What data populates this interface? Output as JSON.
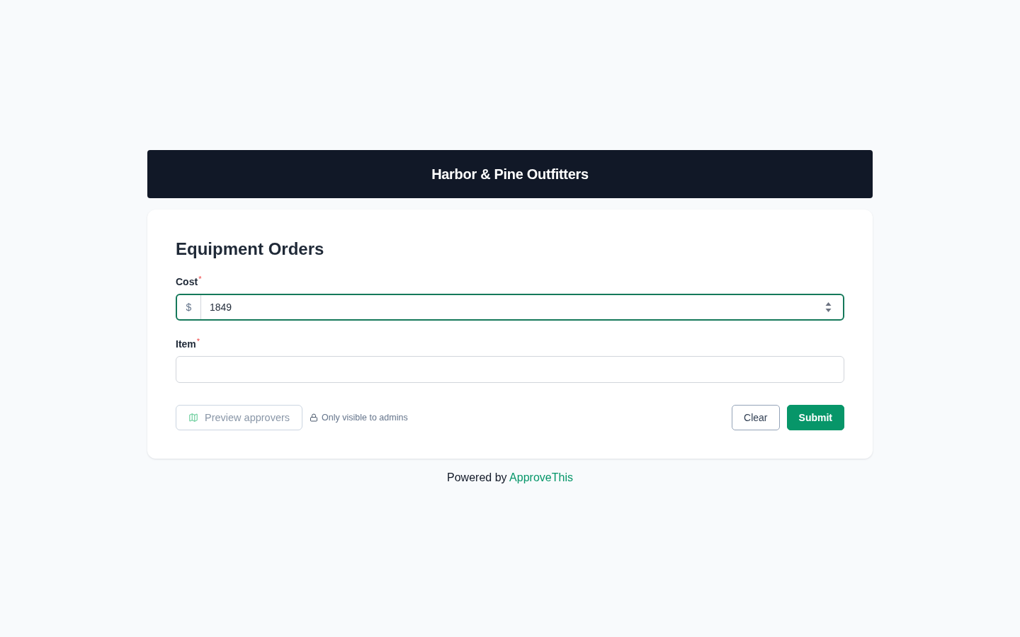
{
  "header": {
    "title": "Harbor & Pine Outfitters"
  },
  "form": {
    "title": "Equipment Orders",
    "fields": [
      {
        "kind": "number",
        "label": "Cost",
        "required_mark": "*",
        "prefix": "$",
        "value": "1849",
        "focused": true
      },
      {
        "kind": "text",
        "label": "Item",
        "required_mark": "*",
        "focused": false
      }
    ],
    "preview_button": {
      "label": "Preview approvers",
      "disabled": true
    },
    "visibility_note": "Only visible to admins",
    "buttons": [
      {
        "kind": "secondary",
        "label": "Clear"
      },
      {
        "kind": "primary",
        "label": "Submit"
      }
    ]
  },
  "footer": {
    "text": "Powered by",
    "link": "ApproveThis"
  }
}
